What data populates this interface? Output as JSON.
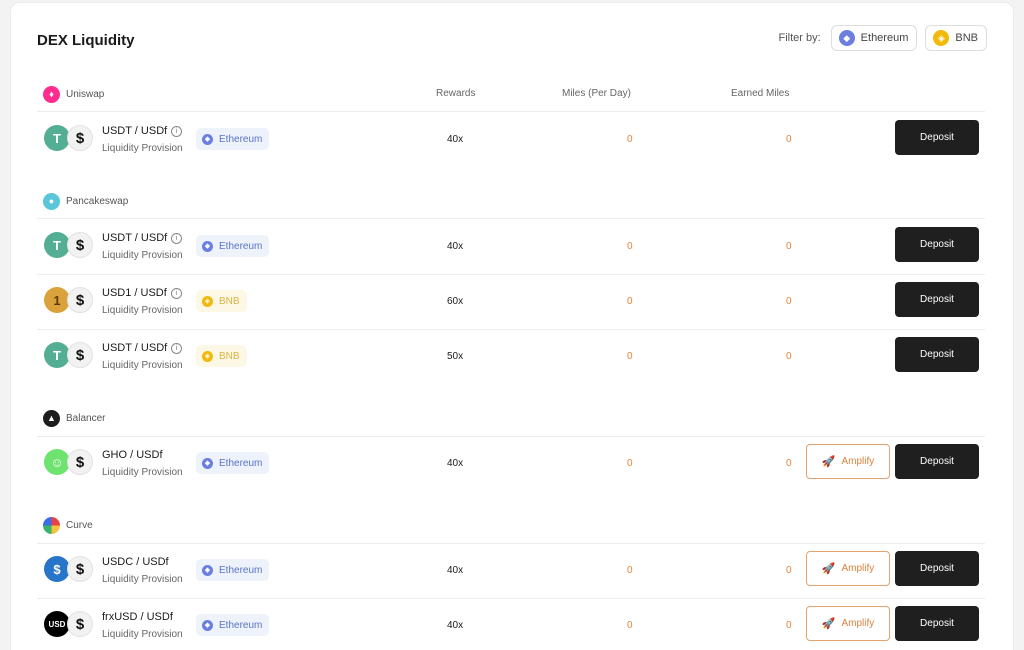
{
  "title": "DEX Liquidity",
  "filter": {
    "label": "Filter by:",
    "options": [
      {
        "label": "Ethereum",
        "icon": "ethereum-icon"
      },
      {
        "label": "BNB",
        "icon": "bnb-icon"
      }
    ]
  },
  "columns": {
    "rewards": "Rewards",
    "miles_per_day": "Miles (Per Day)",
    "earned_miles": "Earned Miles"
  },
  "buttons": {
    "deposit": "Deposit",
    "amplify": "Amplify"
  },
  "sections": [
    {
      "name": "Uniswap",
      "icon": "uniswap-icon",
      "rows": [
        {
          "pair": "USDT / USDf",
          "type": "Liquidity Provision",
          "chain": "Ethereum",
          "rewards": "40x",
          "miles_per_day": "0",
          "earned": "0",
          "info": true,
          "amplify": false
        }
      ]
    },
    {
      "name": "Pancakeswap",
      "icon": "pancakeswap-icon",
      "rows": [
        {
          "pair": "USDT / USDf",
          "type": "Liquidity Provision",
          "chain": "Ethereum",
          "rewards": "40x",
          "miles_per_day": "0",
          "earned": "0",
          "info": true,
          "amplify": false
        },
        {
          "pair": "USD1 / USDf",
          "type": "Liquidity Provision",
          "chain": "BNB",
          "rewards": "60x",
          "miles_per_day": "0",
          "earned": "0",
          "info": true,
          "amplify": false
        },
        {
          "pair": "USDT / USDf",
          "type": "Liquidity Provision",
          "chain": "BNB",
          "rewards": "50x",
          "miles_per_day": "0",
          "earned": "0",
          "info": true,
          "amplify": false
        }
      ]
    },
    {
      "name": "Balancer",
      "icon": "balancer-icon",
      "rows": [
        {
          "pair": "GHO / USDf",
          "type": "Liquidity Provision",
          "chain": "Ethereum",
          "rewards": "40x",
          "miles_per_day": "0",
          "earned": "0",
          "info": false,
          "amplify": true
        }
      ]
    },
    {
      "name": "Curve",
      "icon": "curve-icon",
      "rows": [
        {
          "pair": "USDC / USDf",
          "type": "Liquidity Provision",
          "chain": "Ethereum",
          "rewards": "40x",
          "miles_per_day": "0",
          "earned": "0",
          "info": false,
          "amplify": true
        },
        {
          "pair": "frxUSD / USDf",
          "type": "Liquidity Provision",
          "chain": "Ethereum",
          "rewards": "40x",
          "miles_per_day": "0",
          "earned": "0",
          "info": false,
          "amplify": true
        }
      ]
    }
  ]
}
